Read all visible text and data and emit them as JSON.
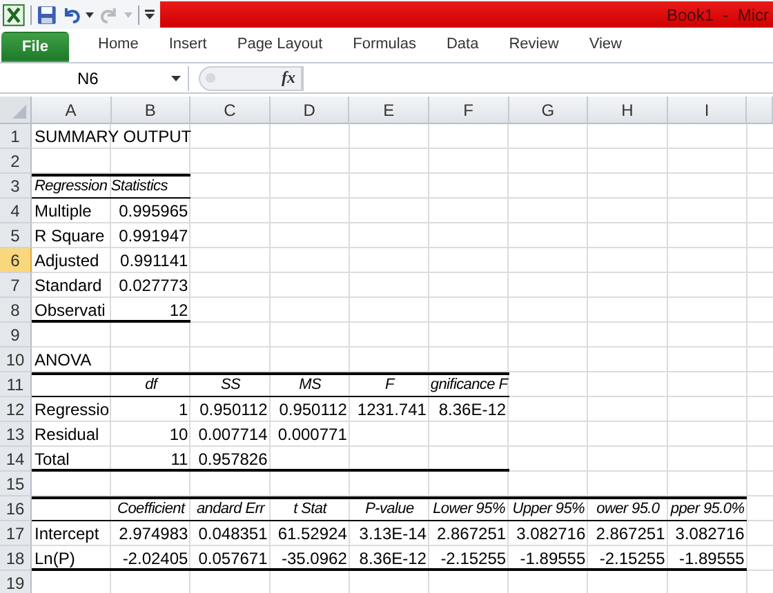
{
  "window": {
    "title": "Book1  -  Micr"
  },
  "ribbon_tabs": [
    {
      "label": "File",
      "kind": "file",
      "selected": false
    },
    {
      "label": "Home",
      "kind": "tab",
      "selected": false
    },
    {
      "label": "Insert",
      "kind": "tab",
      "selected": false
    },
    {
      "label": "Page Layout",
      "kind": "tab",
      "selected": false
    },
    {
      "label": "Formulas",
      "kind": "tab",
      "selected": false
    },
    {
      "label": "Data",
      "kind": "tab",
      "selected": false
    },
    {
      "label": "Review",
      "kind": "tab",
      "selected": false
    },
    {
      "label": "View",
      "kind": "tab",
      "selected": false
    }
  ],
  "name_box": {
    "value": "N6"
  },
  "formula_bar": {
    "function_label": "fx"
  },
  "columns": [
    "A",
    "B",
    "C",
    "D",
    "E",
    "F",
    "G",
    "H",
    "I"
  ],
  "rows": [
    {
      "number": "1",
      "selected": false,
      "kind": "plain",
      "cells": [
        {
          "text": "SUMMARY OUTPUT",
          "kind": "label"
        }
      ]
    },
    {
      "number": "2",
      "selected": false,
      "kind": "plain"
    },
    {
      "number": "3",
      "selected": false,
      "kind": "head",
      "cells": [
        {
          "text": "Regression Statistics",
          "kind": "heading_label"
        },
        null
      ]
    },
    {
      "number": "4",
      "selected": false,
      "kind": "plain",
      "cells": [
        {
          "text": "Multiple",
          "kind": "label"
        },
        {
          "text": "0.995965",
          "kind": "number"
        }
      ]
    },
    {
      "number": "5",
      "selected": false,
      "kind": "plain",
      "cells": [
        {
          "text": "R Square",
          "kind": "label"
        },
        {
          "text": "0.991947",
          "kind": "number"
        }
      ]
    },
    {
      "number": "6",
      "selected": true,
      "kind": "plain",
      "cells": [
        {
          "text": "Adjusted",
          "kind": "label"
        },
        {
          "text": "0.991141",
          "kind": "number"
        }
      ]
    },
    {
      "number": "7",
      "selected": false,
      "kind": "plain",
      "cells": [
        {
          "text": "Standard",
          "kind": "label"
        },
        {
          "text": "0.027773",
          "kind": "number"
        }
      ]
    },
    {
      "number": "8",
      "selected": false,
      "kind": "last",
      "cells": [
        {
          "text": "Observati",
          "kind": "label"
        },
        {
          "text": "12",
          "kind": "number"
        }
      ]
    },
    {
      "number": "9",
      "selected": false,
      "kind": "plain"
    },
    {
      "number": "10",
      "selected": false,
      "kind": "plain",
      "cells": [
        {
          "text": "ANOVA",
          "kind": "label"
        }
      ]
    },
    {
      "number": "11",
      "selected": false,
      "kind": "head",
      "cells": [
        null,
        {
          "text": "df",
          "kind": "heading"
        },
        {
          "text": "SS",
          "kind": "heading"
        },
        {
          "text": "MS",
          "kind": "heading"
        },
        {
          "text": "F",
          "kind": "heading"
        },
        {
          "text": "gnificance F",
          "kind": "heading"
        }
      ]
    },
    {
      "number": "12",
      "selected": false,
      "kind": "plain",
      "cells": [
        {
          "text": "Regressio",
          "kind": "label"
        },
        {
          "text": "1",
          "kind": "number"
        },
        {
          "text": "0.950112",
          "kind": "number"
        },
        {
          "text": "0.950112",
          "kind": "number"
        },
        {
          "text": "1231.741",
          "kind": "number"
        },
        {
          "text": "8.36E-12",
          "kind": "number"
        }
      ]
    },
    {
      "number": "13",
      "selected": false,
      "kind": "plain",
      "cells": [
        {
          "text": "Residual",
          "kind": "label"
        },
        {
          "text": "10",
          "kind": "number"
        },
        {
          "text": "0.007714",
          "kind": "number"
        },
        {
          "text": "0.000771",
          "kind": "number"
        }
      ]
    },
    {
      "number": "14",
      "selected": false,
      "kind": "last",
      "cells": [
        {
          "text": "Total",
          "kind": "label"
        },
        {
          "text": "11",
          "kind": "number"
        },
        {
          "text": "0.957826",
          "kind": "number"
        },
        null,
        null,
        null
      ]
    },
    {
      "number": "15",
      "selected": false,
      "kind": "plain"
    },
    {
      "number": "16",
      "selected": false,
      "kind": "head",
      "cells": [
        null,
        {
          "text": "Coefficient",
          "kind": "heading"
        },
        {
          "text": "andard Err",
          "kind": "heading"
        },
        {
          "text": "t Stat",
          "kind": "heading"
        },
        {
          "text": "P-value",
          "kind": "heading"
        },
        {
          "text": "Lower 95%",
          "kind": "heading"
        },
        {
          "text": "Upper 95%",
          "kind": "heading"
        },
        {
          "text": "ower 95.0",
          "kind": "heading"
        },
        {
          "text": "pper 95.0%",
          "kind": "heading"
        }
      ]
    },
    {
      "number": "17",
      "selected": false,
      "kind": "plain",
      "cells": [
        {
          "text": "Intercept",
          "kind": "label"
        },
        {
          "text": "2.974983",
          "kind": "number"
        },
        {
          "text": "0.048351",
          "kind": "number"
        },
        {
          "text": "61.52924",
          "kind": "number"
        },
        {
          "text": "3.13E-14",
          "kind": "number"
        },
        {
          "text": "2.867251",
          "kind": "number"
        },
        {
          "text": "3.082716",
          "kind": "number"
        },
        {
          "text": "2.867251",
          "kind": "number"
        },
        {
          "text": "3.082716",
          "kind": "number"
        }
      ]
    },
    {
      "number": "18",
      "selected": false,
      "kind": "last",
      "cells": [
        {
          "text": "Ln(P)",
          "kind": "label"
        },
        {
          "text": "-2.02405",
          "kind": "number"
        },
        {
          "text": "0.057671",
          "kind": "number"
        },
        {
          "text": "-35.0962",
          "kind": "number"
        },
        {
          "text": "8.36E-12",
          "kind": "number"
        },
        {
          "text": "-2.15255",
          "kind": "number"
        },
        {
          "text": "-1.89555",
          "kind": "number"
        },
        {
          "text": "-2.15255",
          "kind": "number"
        },
        {
          "text": "-1.89555",
          "kind": "number"
        }
      ]
    },
    {
      "number": "19",
      "selected": false,
      "kind": "plain"
    }
  ]
}
